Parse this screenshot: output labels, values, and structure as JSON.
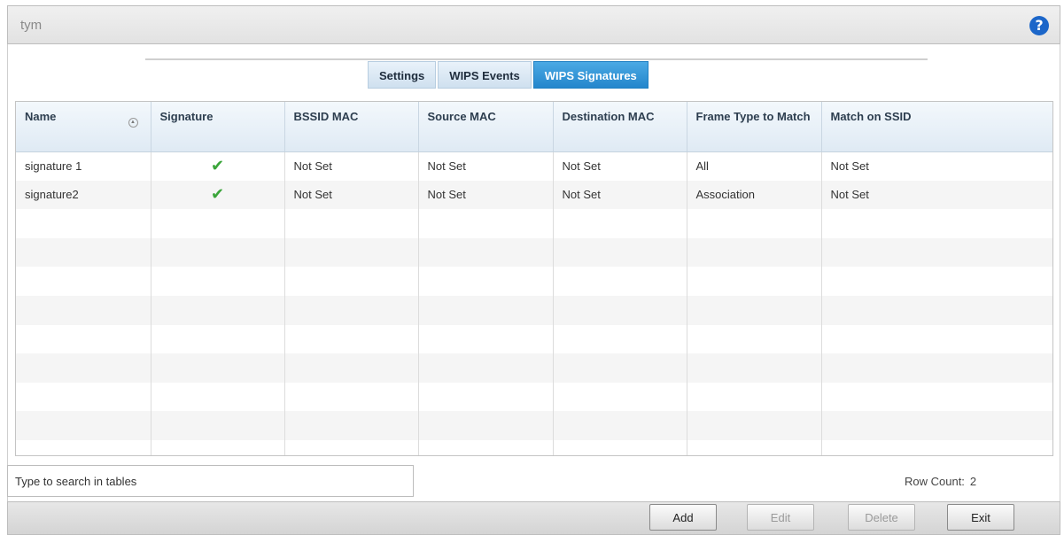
{
  "header": {
    "title": "tym",
    "help_glyph": "?"
  },
  "tabs": [
    {
      "label": "Settings",
      "active": false
    },
    {
      "label": "WIPS Events",
      "active": false
    },
    {
      "label": "WIPS Signatures",
      "active": true
    }
  ],
  "table": {
    "columns": [
      "Name",
      "Signature",
      "BSSID MAC",
      "Source MAC",
      "Destination MAC",
      "Frame Type to Match",
      "Match on SSID"
    ],
    "rows": [
      [
        "signature 1",
        "✔",
        "Not Set",
        "Not Set",
        "Not Set",
        "All",
        "Not Set"
      ],
      [
        "signature2",
        "✔",
        "Not Set",
        "Not Set",
        "Not Set",
        "Association",
        "Not Set"
      ]
    ]
  },
  "search": {
    "placeholder": "Type to search in tables"
  },
  "row_count": {
    "label": "Row Count:",
    "value": "2"
  },
  "buttons": {
    "add": "Add",
    "edit": "Edit",
    "delete": "Delete",
    "exit": "Exit"
  },
  "colors": {
    "accent": "#2486cc",
    "check": "#3aa53a",
    "help": "#1c66c9"
  },
  "icons": {
    "help": "help-icon",
    "sort": "sort-icon",
    "check": "checkmark-icon"
  }
}
